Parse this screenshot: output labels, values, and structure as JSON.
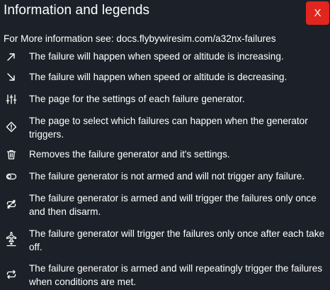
{
  "dialog": {
    "title": "Information and legends",
    "close_label": "X",
    "info_line": "For More information see: docs.flybywiresim.com/a32nx-failures"
  },
  "legend": [
    {
      "icon": "arrow-up-right-icon",
      "text": "The failure will happen when speed or altitude is increasing."
    },
    {
      "icon": "arrow-down-right-icon",
      "text": "The failure will happen when speed or altitude is decreasing."
    },
    {
      "icon": "sliders-icon",
      "text": "The page for the settings of each failure generator."
    },
    {
      "icon": "diamond-alert-icon",
      "text": "The page to select which failures can happen when the generator triggers."
    },
    {
      "icon": "trash-icon",
      "text": "Removes the failure generator and it's settings."
    },
    {
      "icon": "toggle-off-icon",
      "text": "The failure generator is not armed and will not trigger any failure."
    },
    {
      "icon": "repeat-once-icon",
      "text": "The failure generator is armed and will trigger the failures only once and then disarm."
    },
    {
      "icon": "airplane-takeoff-icon",
      "text": "The failure generator will trigger the failures only once after each take off."
    },
    {
      "icon": "repeat-icon",
      "text": "The failure generator is armed and will repeatingly trigger the failures when conditions are met."
    }
  ],
  "colors": {
    "background": "#1c2129",
    "close_button": "#e0271f",
    "text": "#ffffff"
  }
}
